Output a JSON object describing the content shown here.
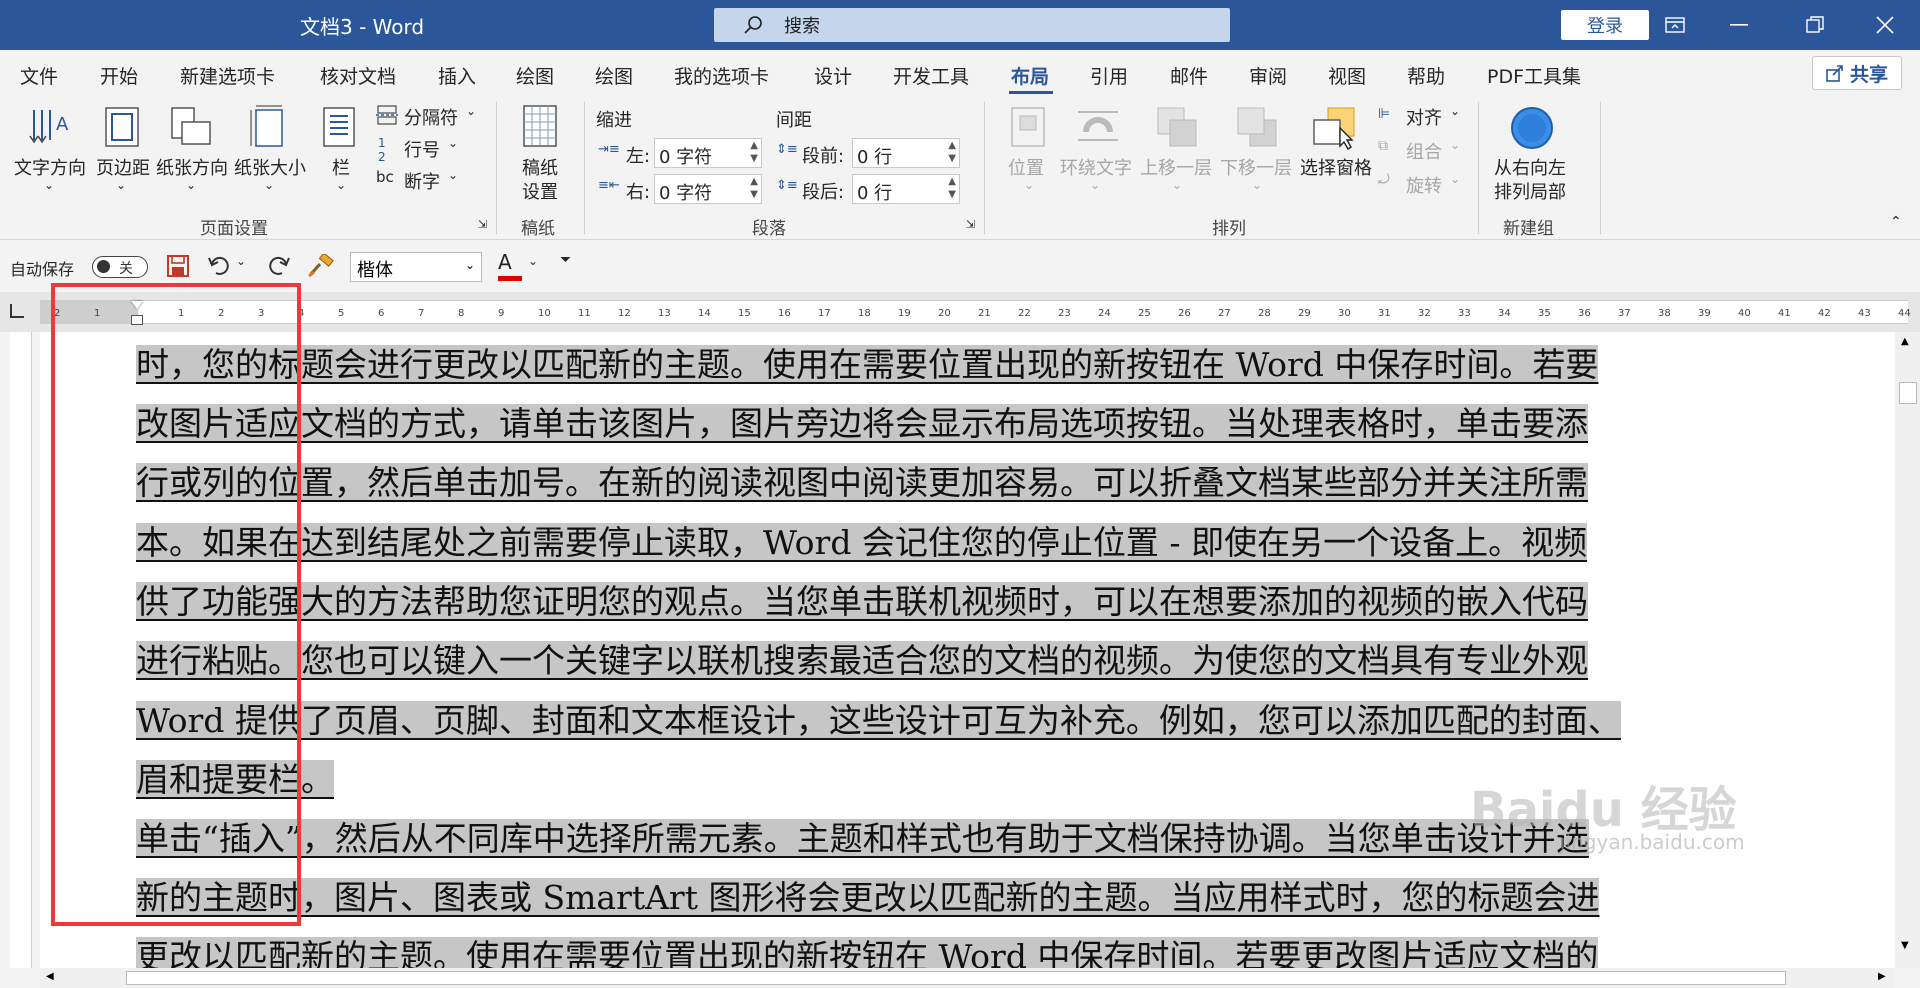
{
  "titlebar": {
    "title": "文档3  -  Word",
    "search_placeholder": "搜索",
    "login_label": "登录"
  },
  "menu": {
    "items": [
      "文件",
      "开始",
      "新建选项卡",
      "核对文档",
      "插入",
      "绘图",
      "绘图",
      "我的选项卡",
      "设计",
      "开发工具",
      "布局",
      "引用",
      "邮件",
      "审阅",
      "视图",
      "帮助",
      "PDF工具集"
    ],
    "active": "布局",
    "share_label": "共享"
  },
  "ribbon": {
    "page_setup": {
      "text_direction": "文字方向",
      "margins": "页边距",
      "orientation": "纸张方向",
      "size": "纸张大小",
      "columns": "栏",
      "breaks": "分隔符",
      "line_numbers": "行号",
      "hyphenation": "断字",
      "label": "页面设置"
    },
    "manuscript": {
      "setup_1": "稿纸",
      "setup_2": "设置",
      "label": "稿纸"
    },
    "paragraph": {
      "indent_title": "缩进",
      "spacing_title": "间距",
      "left_label": "左:",
      "left_value": "0 字符",
      "right_label": "右:",
      "right_value": "0 字符",
      "before_label": "段前:",
      "before_value": "0 行",
      "after_label": "段后:",
      "after_value": "0 行",
      "label": "段落"
    },
    "arrange": {
      "position": "位置",
      "wrap_text": "环绕文字",
      "bring_forward": "上移一层",
      "send_backward": "下移一层",
      "selection_pane": "选择窗格",
      "align": "对齐",
      "group": "组合",
      "rotate": "旋转",
      "label": "排列"
    },
    "new_group": {
      "rtl_1": "从右向左",
      "rtl_2": "排列局部",
      "label": "新建组"
    }
  },
  "qat": {
    "autosave_label": "自动保存",
    "toggle_state": "关",
    "font_name": "楷体",
    "font_color_letter": "A"
  },
  "ruler": {
    "left_ticks": [
      "2",
      "1"
    ],
    "ticks": [
      "1",
      "2",
      "3",
      "4",
      "5",
      "6",
      "7",
      "8",
      "9",
      "10",
      "11",
      "12",
      "13",
      "14",
      "15",
      "16",
      "17",
      "18",
      "19",
      "20",
      "21",
      "22",
      "23",
      "24",
      "25",
      "26",
      "27",
      "28",
      "29",
      "30",
      "31",
      "32",
      "33",
      "34",
      "35",
      "36",
      "37",
      "38",
      "39",
      "40",
      "41",
      "42",
      "43",
      "44"
    ]
  },
  "document": {
    "lines": [
      "时，您的标题会进行更改以匹配新的主题。使用在需要位置出现的新按钮在 Word 中保存时间。若要",
      "改图片适应文档的方式，请单击该图片，图片旁边将会显示布局选项按钮。当处理表格时，单击要添",
      "行或列的位置，然后单击加号。在新的阅读视图中阅读更加容易。可以折叠文档某些部分并关注所需",
      "本。如果在达到结尾处之前需要停止读取，Word 会记住您的停止位置 - 即使在另一个设备上。视频",
      "供了功能强大的方法帮助您证明您的观点。当您单击联机视频时，可以在想要添加的视频的嵌入代码",
      "进行粘贴。您也可以键入一个关键字以联机搜索最适合您的文档的视频。为使您的文档具有专业外观",
      "Word 提供了页眉、页脚、封面和文本框设计，这些设计可互为补充。例如，您可以添加匹配的封面、",
      "眉和提要栏。",
      "单击“插入”，然后从不同库中选择所需元素。主题和样式也有助于文档保持协调。当您单击设计并选",
      "新的主题时，图片、图表或 SmartArt 图形将会更改以匹配新的主题。当应用样式时，您的标题会进",
      "更改以匹配新的主题。使用在需要位置出现的新按钮在 Word 中保存时间。若要更改图片适应文档的"
    ]
  },
  "watermark": {
    "text": "Baidu 经验",
    "url": "jingyan.baidu.com"
  },
  "colors": {
    "title_bar": "#2b579a",
    "highlight": "#c6c6c6",
    "annotation_box": "#f0373b"
  }
}
